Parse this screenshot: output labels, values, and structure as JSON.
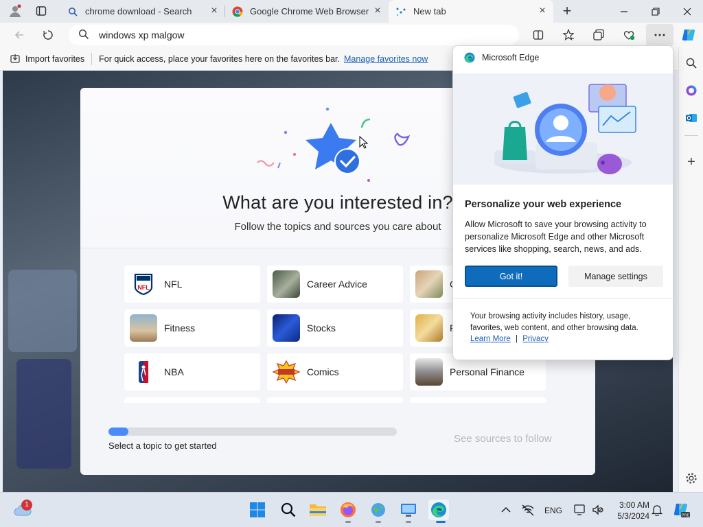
{
  "browser": {
    "tabs": [
      {
        "title": "chrome download - Search",
        "favicon": "search-favicon"
      },
      {
        "title": "Google Chrome Web Browser",
        "favicon": "chrome-favicon"
      },
      {
        "title": "New tab",
        "favicon": "edge-newtab-favicon",
        "active": true
      }
    ],
    "address_bar": {
      "value": "windows xp malgow"
    },
    "favorites_bar": {
      "import_label": "Import favorites",
      "message": "For quick access, place your favorites here on the favorites bar.",
      "manage_link": "Manage favorites now"
    }
  },
  "interest_card": {
    "title": "What are you interested in?",
    "subtitle": "Follow the topics and sources you care about",
    "topics": [
      {
        "label": "NFL",
        "icon": "nfl-logo"
      },
      {
        "label": "Career Advice",
        "icon": "career-photo"
      },
      {
        "label": "C",
        "icon": "photo"
      },
      {
        "label": "Fitness",
        "icon": "fitness-photo"
      },
      {
        "label": "Stocks",
        "icon": "stocks-photo"
      },
      {
        "label": "F",
        "icon": "photo"
      },
      {
        "label": "NBA",
        "icon": "nba-logo"
      },
      {
        "label": "Comics",
        "icon": "comics-photo"
      },
      {
        "label": "Personal Finance",
        "icon": "finance-photo"
      }
    ],
    "progress_fraction": 0.07,
    "progress_text": "Select a topic to get started",
    "next_label": "See sources to follow"
  },
  "popup": {
    "brand": "Microsoft Edge",
    "heading": "Personalize your web experience",
    "body": "Allow Microsoft to save your browsing activity to personalize Microsoft Edge and other Microsoft services like shopping, search, news, and ads.",
    "primary_button": "Got it!",
    "secondary_button": "Manage settings",
    "footer": "Your browsing activity includes history, usage, favorites, web content, and other browsing data.",
    "learn_more": "Learn More",
    "separator": "|",
    "privacy": "Privacy"
  },
  "taskbar": {
    "weather_badge": "1",
    "language": "ENG",
    "time": "3:00 AM",
    "date": "5/3/2024"
  },
  "colors": {
    "accent": "#0f6cbd",
    "progress": "#4a8cf6"
  }
}
